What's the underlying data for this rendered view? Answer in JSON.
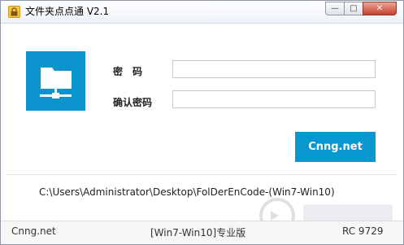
{
  "window": {
    "title": "文件夹点点通 V2.1",
    "controls": {
      "minimize": "—",
      "maximize": "□",
      "close": "✕"
    }
  },
  "form": {
    "password_label": "密　码",
    "confirm_label": "确认密码",
    "password_value": "",
    "confirm_value": "",
    "action_button": "Cnng.net"
  },
  "path": "C:\\Users\\Administrator\\Desktop\\FolDerEnCode-(Win7-Win10)",
  "status": {
    "left": "Cnng.net",
    "middle": "[Win7-Win10]专业版",
    "right": "RC 9729"
  },
  "colors": {
    "accent": "#0997d0",
    "logo": "#0a93cc"
  },
  "icons": {
    "app": "lock-folder-icon",
    "logo": "network-folder-icon"
  }
}
